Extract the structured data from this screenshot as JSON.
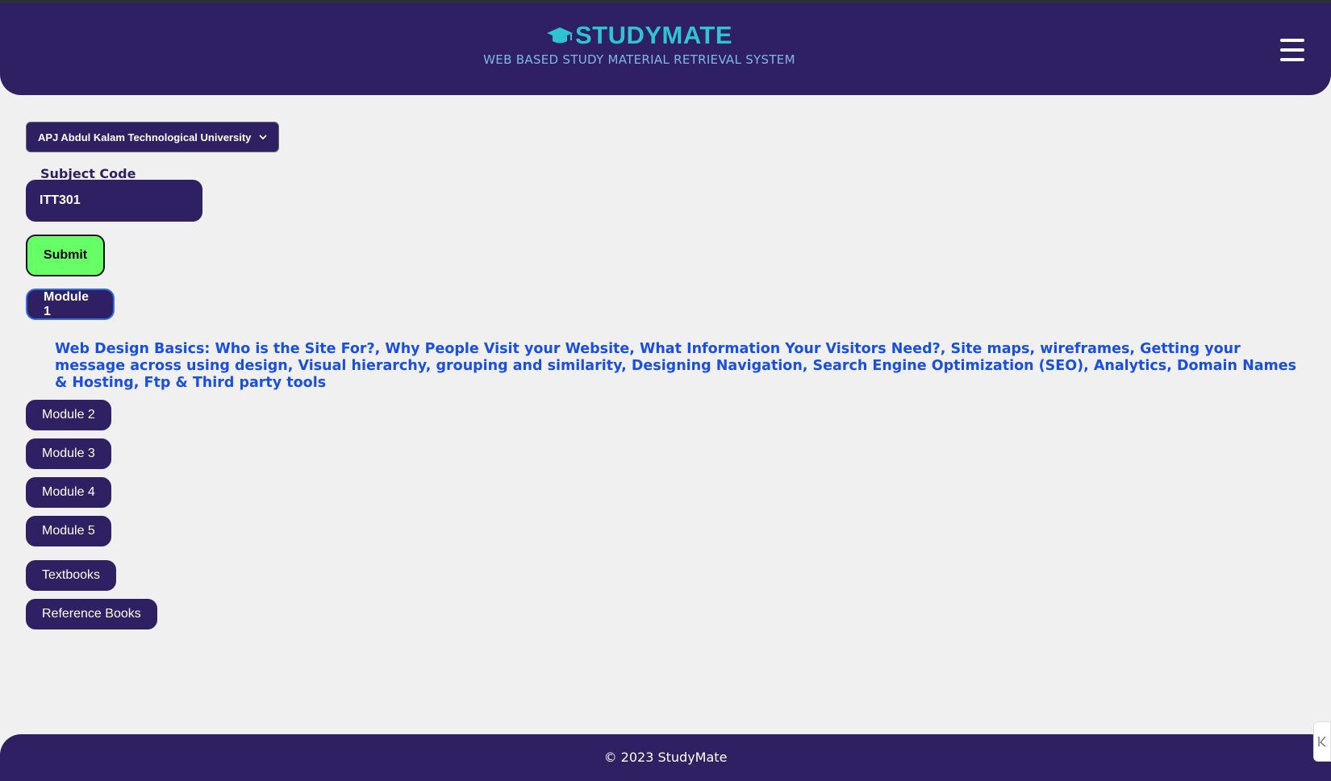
{
  "header": {
    "brand": "STUDYMATE",
    "tagline": "WEB BASED STUDY MATERIAL RETRIEVAL SYSTEM",
    "logo_icon": "graduation-cap-icon",
    "menu_icon": "hamburger-menu-icon",
    "colors": {
      "background": "#2f1f63",
      "brand": "#2ec4d4",
      "tagline": "#7fb7e6"
    }
  },
  "form": {
    "university_selected": "APJ Abdul Kalam Technological University",
    "subject_code_label": "Subject Code",
    "subject_code_value": "ITT301",
    "submit_label": "Submit",
    "submit_color": "#66ff66"
  },
  "modules": [
    {
      "label": "Module 1",
      "active": true
    },
    {
      "label": "Module 2",
      "active": false
    },
    {
      "label": "Module 3",
      "active": false
    },
    {
      "label": "Module 4",
      "active": false
    },
    {
      "label": "Module 5",
      "active": false
    }
  ],
  "module_description": "Web Design Basics: Who is the Site For?, Why People Visit your Website, What Information Your Visitors Need?, Site maps, wireframes, Getting your message across using design, Visual hierarchy, grouping and similarity, Designing Navigation, Search Engine Optimization (SEO), Analytics, Domain Names & Hosting, Ftp & Third party tools",
  "books": {
    "textbooks_label": "Textbooks",
    "reference_label": "Reference Books"
  },
  "footer": {
    "text": "© 2023 StudyMate"
  }
}
